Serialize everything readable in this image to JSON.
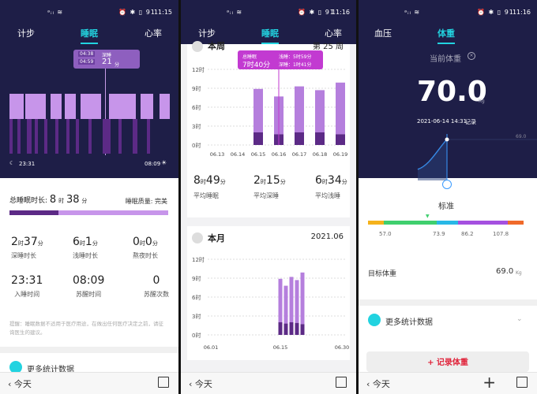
{
  "status": {
    "time1": "11:15",
    "time2": "11:16",
    "time3": "11:16",
    "battery": "91"
  },
  "p1": {
    "tabs": [
      "计步",
      "睡眠",
      "心率"
    ],
    "tooltip": {
      "t1": "04:38",
      "t2": "04:59",
      "type": "深睡",
      "val": "21",
      "unit": "分"
    },
    "start": "23:31",
    "end": "08:09",
    "total_label": "总睡眠时长:",
    "total_h": "8",
    "total_m": "38",
    "h": "时",
    "m": "分",
    "quality_label": "睡眠质量:",
    "quality": "完美",
    "stats": [
      {
        "a": "2",
        "u1": "时",
        "b": "37",
        "u2": "分",
        "label": "深睡时长"
      },
      {
        "a": "6",
        "u1": "时",
        "b": "1",
        "u2": "分",
        "label": "浅睡时长"
      },
      {
        "a": "0",
        "u1": "时",
        "b": "0",
        "u2": "分",
        "label": "熬夜时长"
      }
    ],
    "stats2": [
      {
        "v": "23:31",
        "label": "入睡时间"
      },
      {
        "v": "08:09",
        "label": "苏醒时间"
      },
      {
        "v": "0",
        "label": "苏醒次数"
      }
    ],
    "note": "提醒：睡眠数据不适用于医疗用途，在做出任何医疗决定之前，请征询医生的建议。",
    "more": "更多统计数据",
    "back": "今天"
  },
  "p2": {
    "tabs": [
      "计步",
      "睡眠",
      "心率"
    ],
    "week_title": "本周",
    "week_num": "第 25 周",
    "tooltip": {
      "type": "总睡眠",
      "val": "7时40分",
      "light": "浅睡：5时59分",
      "deep": "深睡：1时41分"
    },
    "yticks": [
      "12时",
      "9时",
      "6时",
      "3时",
      "0时"
    ],
    "chart_data": {
      "type": "bar",
      "categories": [
        "06.13",
        "06.14",
        "06.15",
        "06.16",
        "06.17",
        "06.18",
        "06.19"
      ],
      "series": [
        {
          "name": "深睡",
          "values": [
            0,
            0,
            2.0,
            1.7,
            2.0,
            2.0,
            1.7
          ]
        },
        {
          "name": "浅睡",
          "values": [
            0,
            0,
            6.9,
            6.0,
            7.3,
            6.7,
            8.2
          ]
        }
      ]
    },
    "avg": [
      {
        "a": "8",
        "u1": "时",
        "b": "49",
        "u2": "分",
        "label": "平均睡眠"
      },
      {
        "a": "2",
        "u1": "时",
        "b": "15",
        "u2": "分",
        "label": "平均深睡"
      },
      {
        "a": "6",
        "u1": "时",
        "b": "34",
        "u2": "分",
        "label": "平均浅睡"
      }
    ],
    "month_title": "本月",
    "month_date": "2021.06",
    "month_yticks": [
      "12时",
      "9时",
      "6时",
      "3时",
      "0时"
    ],
    "month_x": [
      "06.01",
      "06.15",
      "06.30"
    ],
    "month_chart": {
      "type": "bar",
      "categories": [
        "06.13",
        "06.14",
        "06.15",
        "06.16",
        "06.17"
      ],
      "series": [
        {
          "name": "深睡",
          "values": [
            2.0,
            1.8,
            2.0,
            1.9,
            1.7
          ]
        },
        {
          "name": "浅睡",
          "values": [
            6.9,
            6.0,
            7.2,
            6.8,
            8.2
          ]
        }
      ]
    },
    "back": "今天"
  },
  "p3": {
    "tabs": [
      "血压",
      "体重"
    ],
    "current_label": "当前体重",
    "weight": "70.0",
    "unit": "Kg",
    "date": "2021-06-14 14:31",
    "record": "记录",
    "line_value": "69.0",
    "status": "标准",
    "scale": [
      "57.0",
      "73.9",
      "86.2",
      "107.8"
    ],
    "target_label": "目标体重",
    "target": "69.0",
    "target_unit": "Kg",
    "more": "更多统计数据",
    "add_btn": "+ 记录体重",
    "back": "今天",
    "colors": [
      "#f5b21c",
      "#3fcf6e",
      "#28b8e6",
      "#a550e0",
      "#f06a2a"
    ]
  }
}
